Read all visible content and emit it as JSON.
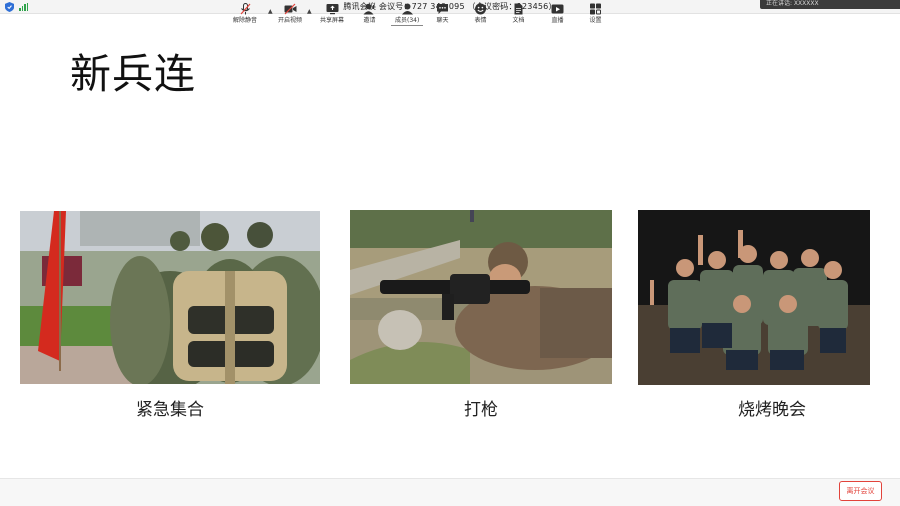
{
  "titlebar": {
    "title": "腾讯会议 会议号：727 340 095 （会议密码：123456）",
    "speaking": "正在讲话: XXXXXX"
  },
  "slide": {
    "title": "新兵连",
    "captions": [
      "紧急集合",
      "打枪",
      "烧烤晚会"
    ]
  },
  "toolbar": {
    "items": [
      "解除静音",
      "开启视频",
      "共享屏幕",
      "邀请",
      "成员(34)",
      "聊天",
      "表情",
      "文档",
      "直播",
      "设置"
    ],
    "leave": "离开会议"
  },
  "colors": {
    "leave_red": "#e2433b",
    "signal_green": "#2ea34a",
    "mute_red": "#e2433b"
  }
}
